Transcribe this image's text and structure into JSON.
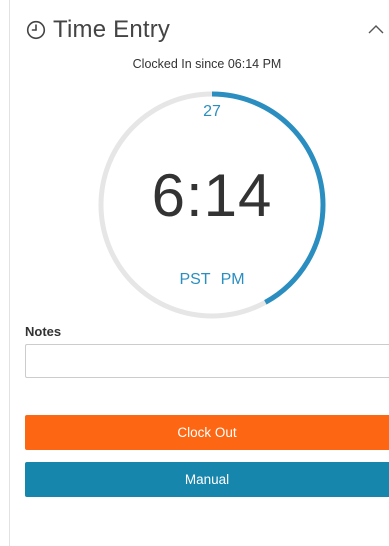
{
  "header": {
    "title": "Time Entry",
    "icon": "clock-icon",
    "collapse_icon": "chevron-up-icon"
  },
  "status": {
    "text": "Clocked In since 06:14 PM"
  },
  "dial": {
    "date": "27",
    "time": "6:14",
    "timezone": "PST",
    "meridiem": "PM",
    "progress_fraction": 0.42,
    "progress_color": "#2a8ec0",
    "track_color": "#e6e6e6"
  },
  "notes": {
    "label": "Notes",
    "value": "",
    "placeholder": ""
  },
  "actions": {
    "clock_out_label": "Clock Out",
    "clock_out_color": "#fd6714",
    "manual_label": "Manual",
    "manual_color": "#1786ad"
  }
}
